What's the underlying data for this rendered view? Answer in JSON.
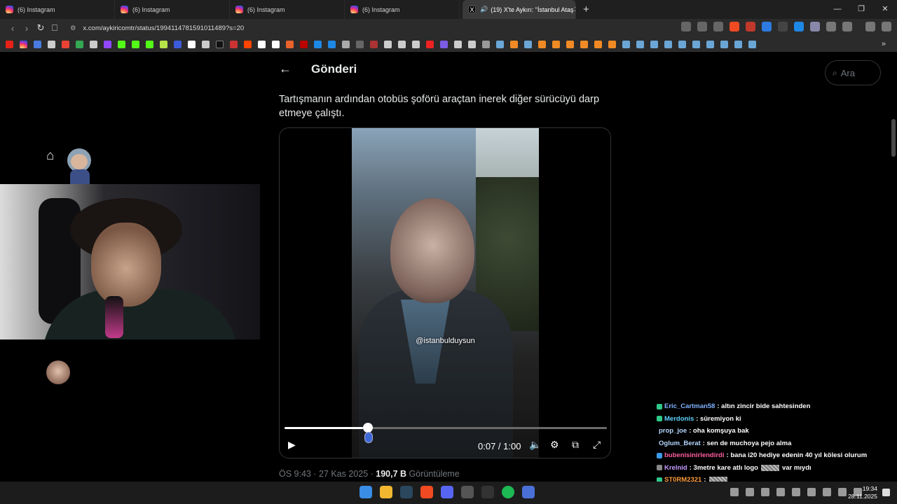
{
  "browser": {
    "tabs": [
      {
        "label": "(6) Instagram",
        "icon": "instagram-icon"
      },
      {
        "label": "(6) Instagram",
        "icon": "instagram-icon"
      },
      {
        "label": "(6) Instagram",
        "icon": "instagram-icon"
      },
      {
        "label": "(6) Instagram",
        "icon": "instagram-icon"
      },
      {
        "label": "(19) X'te Aykırı: \"İstanbul Ataş",
        "icon": "x-icon",
        "active": true
      }
    ],
    "url": "x.com/aykiricomtr/status/1994114781591011489?s=20",
    "new_tab": "+",
    "window_controls": {
      "minimize": "—",
      "maximize": "❐",
      "close": "✕"
    }
  },
  "post": {
    "header_title": "Gönderi",
    "back_glyph": "←",
    "search_placeholder": "Ara",
    "text": "Tartışmanın ardından otobüs şoförü araçtan inerek diğer sürücüyü darp etmeye çalıştı.",
    "video": {
      "watermark": "@istanbulduysun",
      "time": "0:07 / 1:00",
      "progress": 0.13
    },
    "meta_time": "ÖS 9:43 · 27 Kas 2025 · ",
    "meta_views_count": "190,7 B",
    "meta_views_label": " Görüntüleme"
  },
  "chat": [
    {
      "user": "Eric_Cartman58",
      "color": "#7fb2ff",
      "badge": "#2fc98b",
      "message": ": altın zincir bide sahtesinden"
    },
    {
      "user": "Merdonis",
      "color": "#5fd3ff",
      "badge": "#2fc98b",
      "message": ": süremiyon ki"
    },
    {
      "user": "prop_joe",
      "color": "#b6d7ff",
      "badge": "",
      "message": ": oha komşuya bak"
    },
    {
      "user": "Oglum_Berat",
      "color": "#b6d7ff",
      "badge": "",
      "message": ": sen de muchoya pejo alma"
    },
    {
      "user": "bubenisinirlendirdi",
      "color": "#ff5fa0",
      "badge": "#3b9ae8",
      "message": ": bana i20 hediye edenin 40 yıl kölesi olurum"
    },
    {
      "user": "Krelnid",
      "color": "#c79cff",
      "badge": "#888888",
      "message": ": 3metre kare atlı logo",
      "suffix": " var mıydı",
      "redacted": true
    },
    {
      "user": "ST0RM2321",
      "color": "#ff9b3d",
      "badge": "#2fc98b",
      "message": ":",
      "redacted": true
    }
  ],
  "taskbar": {
    "time": "19:34",
    "date": "28.11.2025"
  }
}
